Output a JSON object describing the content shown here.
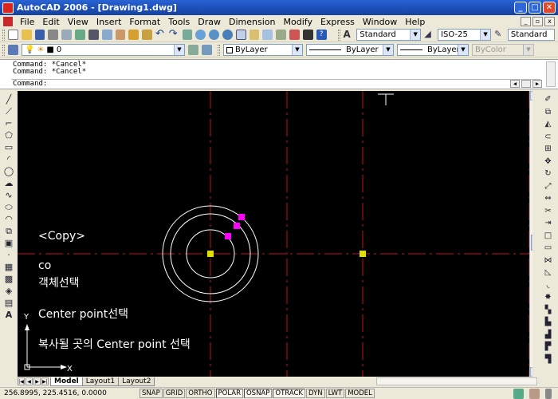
{
  "window": {
    "title": "AutoCAD 2006 - [Drawing1.dwg]",
    "minimize": "_",
    "maximize": "□",
    "close": "✕"
  },
  "menu": {
    "items": [
      "File",
      "Edit",
      "View",
      "Insert",
      "Format",
      "Tools",
      "Draw",
      "Dimension",
      "Modify",
      "Express",
      "Window",
      "Help"
    ]
  },
  "toolbar1": {
    "text_style": "Standard",
    "dim_style": "ISO-25",
    "table_style": "Standard"
  },
  "toolbar2": {
    "layer": "0",
    "color": "ByLayer",
    "linetype": "ByLayer",
    "lineweight": "ByLayer",
    "plotstyle": "ByColor"
  },
  "command": {
    "history": [
      "Command: *Cancel*",
      "Command: *Cancel*"
    ],
    "prompt": "Command:"
  },
  "annotations": {
    "copy_title": "<Copy>",
    "co": "co",
    "select_object": "객체선택",
    "center_point": "Center point선택",
    "dest_point": "복사될 곳의 Center point 선택"
  },
  "ucs": {
    "y_label": "Y",
    "x_label": "X"
  },
  "tabs": [
    "Model",
    "Layout1",
    "Layout2"
  ],
  "status": {
    "coordinates": "256.8995, 225.4516, 0.0000",
    "buttons": [
      {
        "label": "SNAP",
        "on": false
      },
      {
        "label": "GRID",
        "on": false
      },
      {
        "label": "ORTHO",
        "on": false
      },
      {
        "label": "POLAR",
        "on": true
      },
      {
        "label": "OSNAP",
        "on": true
      },
      {
        "label": "OTRACK",
        "on": true
      },
      {
        "label": "DYN",
        "on": false
      },
      {
        "label": "LWT",
        "on": false
      },
      {
        "label": "MODEL",
        "on": false
      }
    ]
  },
  "colors": {
    "centerline": "#c0141c",
    "grip_hot": "#ff00ff",
    "grip_cold": "#e0e000",
    "canvas": "#000000",
    "geometry": "#ffffff"
  }
}
